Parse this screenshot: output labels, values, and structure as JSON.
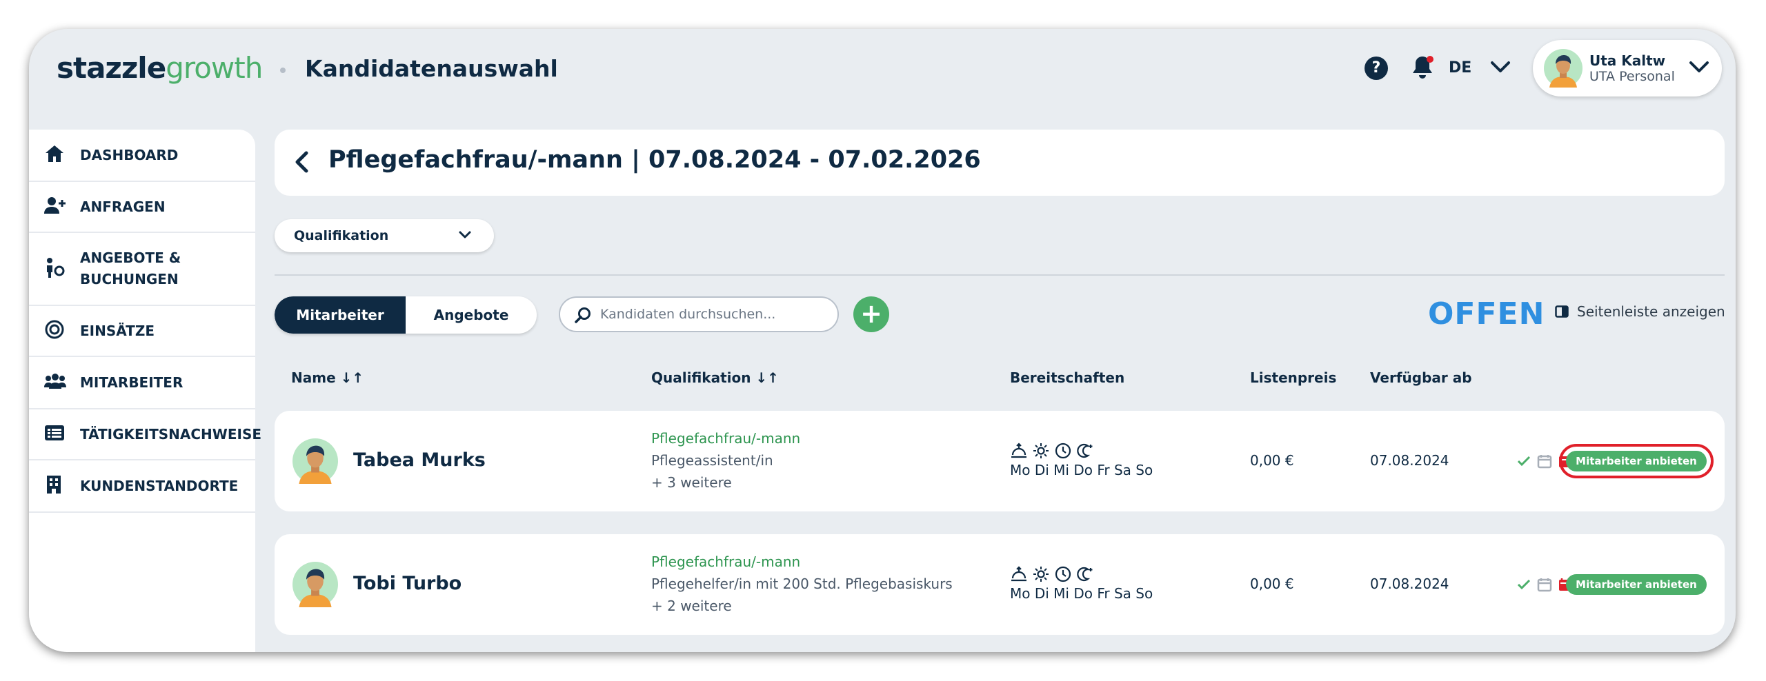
{
  "brand": {
    "part1": "stazzle",
    "part2": "growth"
  },
  "header": {
    "page_title": "Kandidatenauswahl",
    "help": "?",
    "language": "DE",
    "user_name": "Uta Kaltw",
    "user_org": "UTA Personal"
  },
  "sidebar": {
    "items": [
      {
        "label": "DASHBOARD",
        "icon": "home-icon"
      },
      {
        "label": "ANFRAGEN",
        "icon": "add-user-icon"
      },
      {
        "label": "ANGEBOTE & BUCHUNGEN",
        "icon": "person-offer-icon"
      },
      {
        "label": "EINSÄTZE",
        "icon": "target-icon"
      },
      {
        "label": "MITARBEITER",
        "icon": "group-icon"
      },
      {
        "label": "TÄTIGKEITSNACHWEISE",
        "icon": "list-card-icon"
      },
      {
        "label": "KUNDENSTANDORTE",
        "icon": "building-icon"
      }
    ]
  },
  "main": {
    "job_title": "Pflegefachfrau/-mann | 07.08.2024 - 07.02.2026",
    "qual_filter": "Qualifikation",
    "tabs": [
      "Mitarbeiter",
      "Angebote"
    ],
    "search_placeholder": "Kandidaten durchsuchen...",
    "add_label": "+",
    "status": "OFFEN",
    "sidebar_toggle": "Seitenleiste anzeigen",
    "columns": {
      "name": "Name ↓↑",
      "qual": "Qualifikation ↓↑",
      "bereit": "Bereitschaften",
      "preis": "Listenpreis",
      "verf": "Verfügbar ab"
    },
    "rows": [
      {
        "name": "Tabea Murks",
        "qual1": "Pflegefachfrau/-mann",
        "qual2": "Pflegeassistent/in",
        "qual3": "+ 3 weitere",
        "days": "Mo Di Mi Do Fr Sa So",
        "price": "0,00 €",
        "available": "07.08.2024",
        "action": "Mitarbeiter anbieten"
      },
      {
        "name": "Tobi Turbo",
        "qual1": "Pflegefachfrau/-mann",
        "qual2": "Pflegehelfer/in mit 200 Std. Pflegebasiskurs",
        "qual3": "+ 2 weitere",
        "days": "Mo Di Mi Do Fr Sa So",
        "price": "0,00 €",
        "available": "07.08.2024",
        "action": "Mitarbeiter anbieten"
      }
    ]
  },
  "colors": {
    "accent": "#4caf6a",
    "navy": "#0f2a43",
    "status_blue": "#2f8fe0",
    "highlight": "#e0202a"
  }
}
